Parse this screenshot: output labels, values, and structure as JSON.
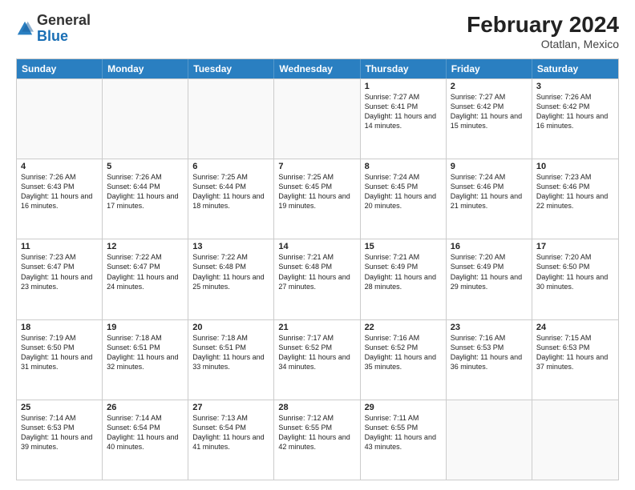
{
  "header": {
    "logo_general": "General",
    "logo_blue": "Blue",
    "month_year": "February 2024",
    "location": "Otatlan, Mexico"
  },
  "days_of_week": [
    "Sunday",
    "Monday",
    "Tuesday",
    "Wednesday",
    "Thursday",
    "Friday",
    "Saturday"
  ],
  "rows": [
    [
      {
        "day": "",
        "info": ""
      },
      {
        "day": "",
        "info": ""
      },
      {
        "day": "",
        "info": ""
      },
      {
        "day": "",
        "info": ""
      },
      {
        "day": "1",
        "info": "Sunrise: 7:27 AM\nSunset: 6:41 PM\nDaylight: 11 hours and 14 minutes."
      },
      {
        "day": "2",
        "info": "Sunrise: 7:27 AM\nSunset: 6:42 PM\nDaylight: 11 hours and 15 minutes."
      },
      {
        "day": "3",
        "info": "Sunrise: 7:26 AM\nSunset: 6:42 PM\nDaylight: 11 hours and 16 minutes."
      }
    ],
    [
      {
        "day": "4",
        "info": "Sunrise: 7:26 AM\nSunset: 6:43 PM\nDaylight: 11 hours and 16 minutes."
      },
      {
        "day": "5",
        "info": "Sunrise: 7:26 AM\nSunset: 6:44 PM\nDaylight: 11 hours and 17 minutes."
      },
      {
        "day": "6",
        "info": "Sunrise: 7:25 AM\nSunset: 6:44 PM\nDaylight: 11 hours and 18 minutes."
      },
      {
        "day": "7",
        "info": "Sunrise: 7:25 AM\nSunset: 6:45 PM\nDaylight: 11 hours and 19 minutes."
      },
      {
        "day": "8",
        "info": "Sunrise: 7:24 AM\nSunset: 6:45 PM\nDaylight: 11 hours and 20 minutes."
      },
      {
        "day": "9",
        "info": "Sunrise: 7:24 AM\nSunset: 6:46 PM\nDaylight: 11 hours and 21 minutes."
      },
      {
        "day": "10",
        "info": "Sunrise: 7:23 AM\nSunset: 6:46 PM\nDaylight: 11 hours and 22 minutes."
      }
    ],
    [
      {
        "day": "11",
        "info": "Sunrise: 7:23 AM\nSunset: 6:47 PM\nDaylight: 11 hours and 23 minutes."
      },
      {
        "day": "12",
        "info": "Sunrise: 7:22 AM\nSunset: 6:47 PM\nDaylight: 11 hours and 24 minutes."
      },
      {
        "day": "13",
        "info": "Sunrise: 7:22 AM\nSunset: 6:48 PM\nDaylight: 11 hours and 25 minutes."
      },
      {
        "day": "14",
        "info": "Sunrise: 7:21 AM\nSunset: 6:48 PM\nDaylight: 11 hours and 27 minutes."
      },
      {
        "day": "15",
        "info": "Sunrise: 7:21 AM\nSunset: 6:49 PM\nDaylight: 11 hours and 28 minutes."
      },
      {
        "day": "16",
        "info": "Sunrise: 7:20 AM\nSunset: 6:49 PM\nDaylight: 11 hours and 29 minutes."
      },
      {
        "day": "17",
        "info": "Sunrise: 7:20 AM\nSunset: 6:50 PM\nDaylight: 11 hours and 30 minutes."
      }
    ],
    [
      {
        "day": "18",
        "info": "Sunrise: 7:19 AM\nSunset: 6:50 PM\nDaylight: 11 hours and 31 minutes."
      },
      {
        "day": "19",
        "info": "Sunrise: 7:18 AM\nSunset: 6:51 PM\nDaylight: 11 hours and 32 minutes."
      },
      {
        "day": "20",
        "info": "Sunrise: 7:18 AM\nSunset: 6:51 PM\nDaylight: 11 hours and 33 minutes."
      },
      {
        "day": "21",
        "info": "Sunrise: 7:17 AM\nSunset: 6:52 PM\nDaylight: 11 hours and 34 minutes."
      },
      {
        "day": "22",
        "info": "Sunrise: 7:16 AM\nSunset: 6:52 PM\nDaylight: 11 hours and 35 minutes."
      },
      {
        "day": "23",
        "info": "Sunrise: 7:16 AM\nSunset: 6:53 PM\nDaylight: 11 hours and 36 minutes."
      },
      {
        "day": "24",
        "info": "Sunrise: 7:15 AM\nSunset: 6:53 PM\nDaylight: 11 hours and 37 minutes."
      }
    ],
    [
      {
        "day": "25",
        "info": "Sunrise: 7:14 AM\nSunset: 6:53 PM\nDaylight: 11 hours and 39 minutes."
      },
      {
        "day": "26",
        "info": "Sunrise: 7:14 AM\nSunset: 6:54 PM\nDaylight: 11 hours and 40 minutes."
      },
      {
        "day": "27",
        "info": "Sunrise: 7:13 AM\nSunset: 6:54 PM\nDaylight: 11 hours and 41 minutes."
      },
      {
        "day": "28",
        "info": "Sunrise: 7:12 AM\nSunset: 6:55 PM\nDaylight: 11 hours and 42 minutes."
      },
      {
        "day": "29",
        "info": "Sunrise: 7:11 AM\nSunset: 6:55 PM\nDaylight: 11 hours and 43 minutes."
      },
      {
        "day": "",
        "info": ""
      },
      {
        "day": "",
        "info": ""
      }
    ]
  ]
}
